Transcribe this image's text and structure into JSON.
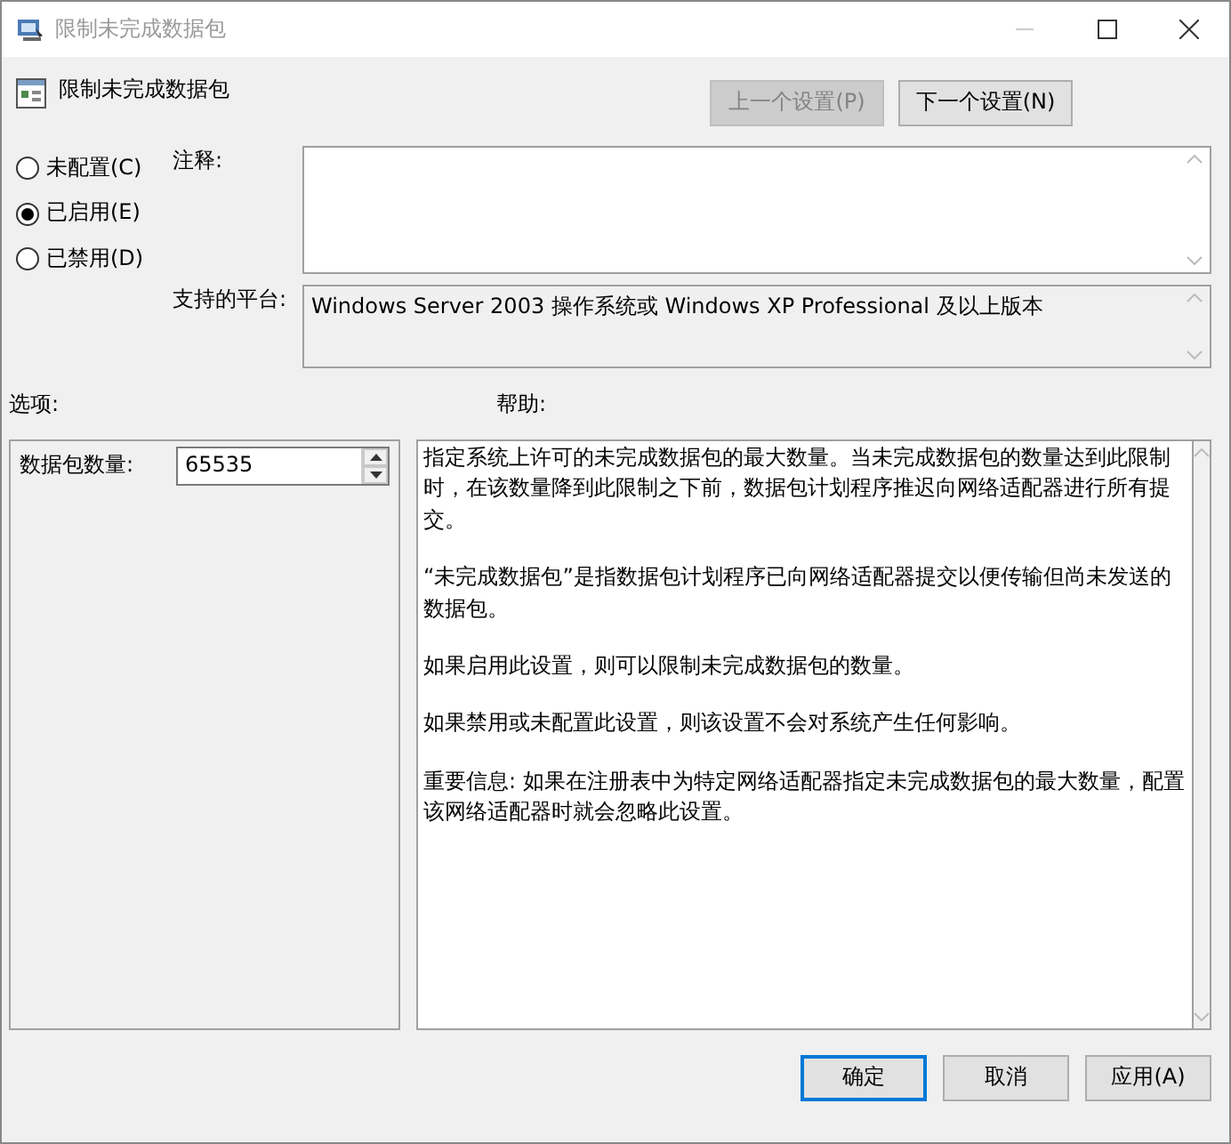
{
  "window": {
    "title": "限制未完成数据包"
  },
  "header": {
    "title": "限制未完成数据包"
  },
  "nav_buttons": [
    {
      "label": "上一个设置(P)",
      "disabled": true
    },
    {
      "label": "下一个设置(N)",
      "disabled": false
    }
  ],
  "radios": [
    {
      "label": "未配置(C)",
      "selected": false
    },
    {
      "label": "已启用(E)",
      "selected": true
    },
    {
      "label": "已禁用(D)",
      "selected": false
    }
  ],
  "comment": {
    "label": "注释:"
  },
  "platform": {
    "label": "支持的平台:",
    "value": "Windows Server 2003 操作系统或 Windows XP Professional 及以上版本"
  },
  "options_label": "选项:",
  "help_label": "帮助:",
  "options": [
    {
      "label": "数据包数量:",
      "value": "65535"
    }
  ],
  "help_paragraphs": [
    "指定系统上许可的未完成数据包的最大数量。当未完成数据包的数量达到此限制时，在该数量降到此限制之下前，数据包计划程序推迟向网络适配器进行所有提交。",
    "“未完成数据包”是指数据包计划程序已向网络适配器提交以便传输但尚未发送的数据包。",
    "如果启用此设置，则可以限制未完成数据包的数量。",
    "如果禁用或未配置此设置，则该设置不会对系统产生任何影响。",
    "重要信息: 如果在注册表中为特定网络适配器指定未完成数据包的最大数量，配置该网络适配器时就会忽略此设置。"
  ],
  "buttons": [
    {
      "label": "确定",
      "default": true
    },
    {
      "label": "取消",
      "default": false
    },
    {
      "label": "应用(A)",
      "default": false
    }
  ]
}
